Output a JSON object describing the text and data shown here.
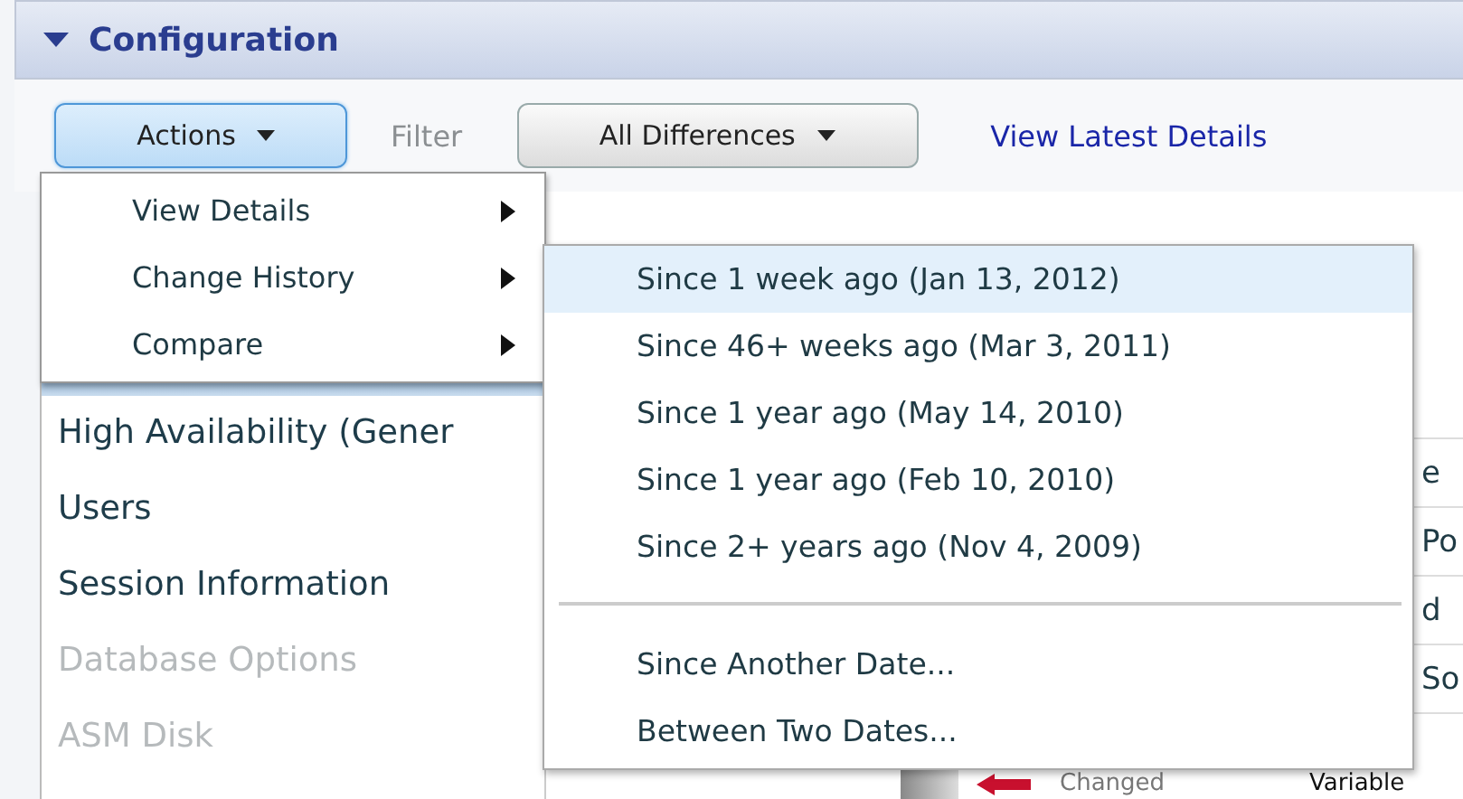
{
  "header": {
    "title": "Configuration",
    "expanded": true
  },
  "toolbar": {
    "actions": {
      "label": "Actions",
      "pressed": true
    },
    "filter_label": "Filter",
    "filter": {
      "label": "All Differences"
    },
    "link": "View Latest Details"
  },
  "navigation": [
    {
      "label": "High Availability (Gener",
      "disabled": false
    },
    {
      "label": "Users",
      "disabled": false
    },
    {
      "label": "Session Information",
      "disabled": false
    },
    {
      "label": "Database Options",
      "disabled": true
    },
    {
      "label": "ASM Disk",
      "disabled": true
    }
  ],
  "table_rows": [
    {
      "column_1": "e"
    },
    {
      "column_1": "Po"
    },
    {
      "column_1": "d"
    },
    {
      "column_1": "So"
    }
  ],
  "bottom_row": {
    "status": "Changed",
    "column_2": "Variable"
  },
  "actions_menu": [
    {
      "label": "View Details",
      "has_submenu": true
    },
    {
      "label": "Change History",
      "has_submenu": true
    },
    {
      "label": "Compare",
      "has_submenu": true
    }
  ],
  "history_menu": [
    [
      {
        "label": "Since 1 week ago (Jan 13, 2012)",
        "selected": true
      },
      {
        "label": "Since 46+ weeks ago (Mar 3, 2011)",
        "selected": false
      },
      {
        "label": "Since 1 year ago (May 14, 2010)",
        "selected": false
      },
      {
        "label": "Since 1 year ago (Feb 10, 2010)",
        "selected": false
      },
      {
        "label": "Since 2+ years ago (Nov 4, 2009)",
        "selected": false
      }
    ],
    [
      {
        "label": "Since Another Date...",
        "selected": false
      },
      {
        "label": "Between Two Dates...",
        "selected": false
      }
    ]
  ]
}
